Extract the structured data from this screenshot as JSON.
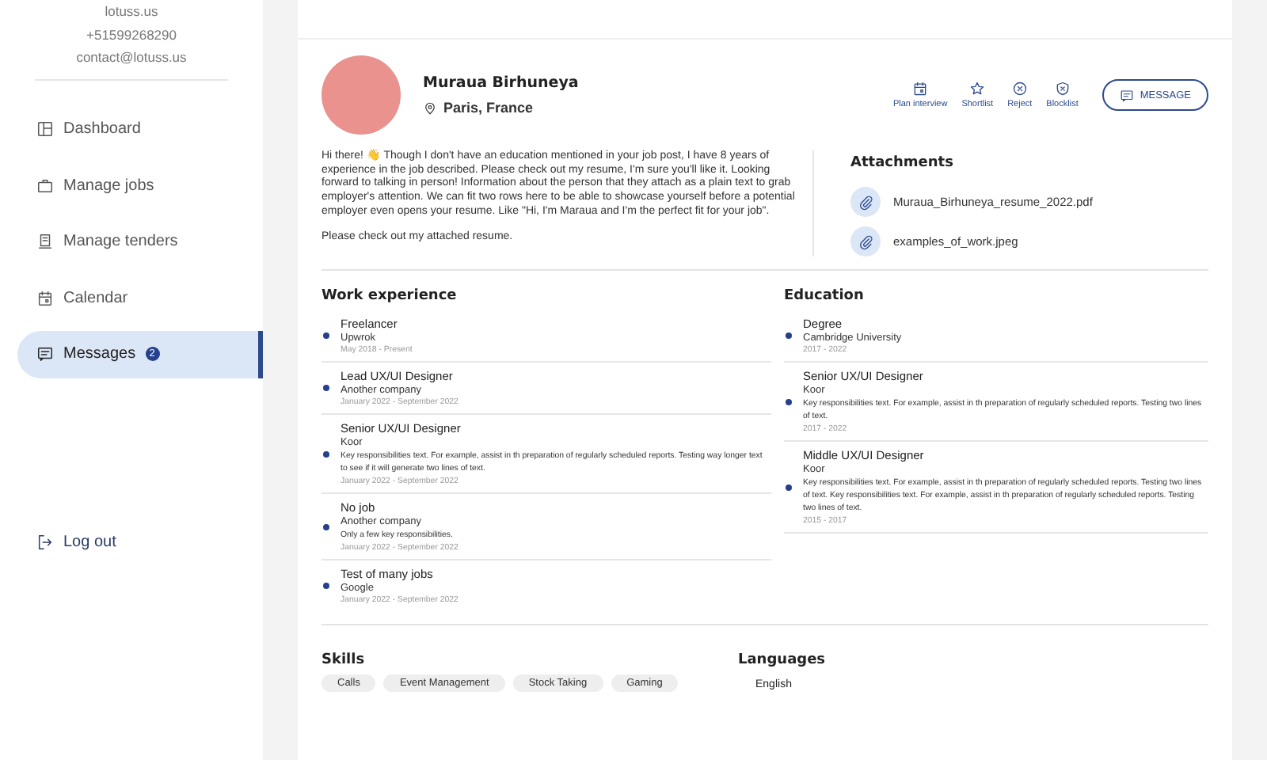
{
  "sidebar": {
    "contact": [
      "lotuss.us",
      "+51599268290",
      "contact@lotuss.us"
    ],
    "items": [
      {
        "label": "Dashboard",
        "kind": "dashboard",
        "selected": false
      },
      {
        "label": "Manage jobs",
        "kind": "jobs",
        "selected": false
      },
      {
        "label": "Manage tenders",
        "kind": "tenders",
        "selected": false
      },
      {
        "label": "Calendar",
        "kind": "calendar",
        "selected": false
      },
      {
        "label": "Messages",
        "kind": "messages",
        "badge": "2",
        "selected": true
      }
    ],
    "logout": "Log out"
  },
  "profile": {
    "name": "Muraua Birhuneya",
    "location": "Paris, France",
    "actions": [
      {
        "label": "Plan interview",
        "kind": "interview"
      },
      {
        "label": "Shortlist",
        "kind": "shortlist"
      },
      {
        "label": "Reject",
        "kind": "reject"
      },
      {
        "label": "Blocklist",
        "kind": "blocklist"
      }
    ],
    "message_button": "MESSAGE"
  },
  "bio": [
    "Hi there! 👋 Though I don't have an education mentioned in your job post, I have 8 years of experience in the job described. Please check out my resume, I'm sure you'll like it. Looking forward to talking in person! Information about the person that they attach as a plain text to grab employer's attention. We can fit two rows here to be able to showcase yourself before a potential employer even opens your resume. Like \"Hi, I'm Maraua and I'm the perfect fit for your job\".",
    "Please check out my attached resume."
  ],
  "attachments": {
    "title": "Attachments",
    "files": [
      "Muraua_Birhuneya_resume_2022.pdf",
      "examples_of_work.jpeg"
    ]
  },
  "work_experience": {
    "title": "Work experience",
    "items": [
      {
        "title": "Freelancer",
        "company": "Upwrok",
        "dates": "May 2018 - Present"
      },
      {
        "title": "Lead UX/UI Designer",
        "company": "Another company",
        "dates": "January 2022 - September 2022"
      },
      {
        "title": "Senior UX/UI Designer",
        "company": "Koor",
        "description": "Key responsibilities text. For example, assist in th preparation of regularly scheduled reports. Testing way longer text to see if it will generate two lines of text.",
        "dates": "January 2022 - September 2022"
      },
      {
        "title": "No job",
        "company": "Another company",
        "description": "Only a few key responsibilities.",
        "dates": "January 2022 - September 2022"
      },
      {
        "title": "Test of many jobs",
        "company": "Google",
        "dates": "January 2022 - September 2022"
      }
    ]
  },
  "education": {
    "title": "Education",
    "items": [
      {
        "title": "Degree",
        "company": "Cambridge University",
        "dates": "2017 - 2022"
      },
      {
        "title": "Senior UX/UI Designer",
        "company": "Koor",
        "description": "Key responsibilities text. For example, assist in th preparation of regularly scheduled reports. Testing two lines of text.",
        "dates": "2017 - 2022"
      },
      {
        "title": "Middle UX/UI Designer",
        "company": "Koor",
        "description": "Key responsibilities text. For example, assist in th preparation of regularly scheduled reports. Testing two lines of text. Key responsibilities text. For example, assist in th preparation of regularly scheduled reports. Testing two lines of text.",
        "dates": "2015 - 2017"
      }
    ]
  },
  "skills": {
    "title": "Skills",
    "items": [
      "Calls",
      "Event Management",
      "Stock Taking",
      "Gaming"
    ]
  },
  "languages": {
    "title": "Languages",
    "items": [
      "English"
    ]
  }
}
